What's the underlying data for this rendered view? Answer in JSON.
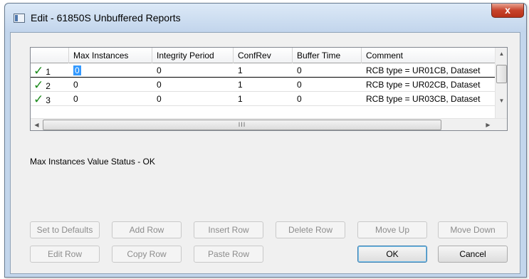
{
  "window": {
    "title": "Edit - 61850S Unbuffered Reports",
    "close_label": "x"
  },
  "grid": {
    "columns": [
      "Max Instances",
      "Integrity Period",
      "ConfRev",
      "Buffer Time",
      "Comment"
    ],
    "rows": [
      {
        "num": "1",
        "check": "✓",
        "max_instances": "0",
        "integrity_period": "0",
        "confrev": "1",
        "buffer_time": "0",
        "comment": "RCB type = UR01CB, Dataset"
      },
      {
        "num": "2",
        "check": "✓",
        "max_instances": "0",
        "integrity_period": "0",
        "confrev": "1",
        "buffer_time": "0",
        "comment": "RCB type = UR02CB, Dataset"
      },
      {
        "num": "3",
        "check": "✓",
        "max_instances": "0",
        "integrity_period": "0",
        "confrev": "1",
        "buffer_time": "0",
        "comment": "RCB type = UR03CB, Dataset"
      }
    ],
    "hscroll_grip": "III"
  },
  "status_text": "Max Instances Value Status - OK",
  "buttons": {
    "set_to_defaults": "Set to Defaults",
    "add_row": "Add Row",
    "insert_row": "Insert Row",
    "delete_row": "Delete Row",
    "move_up": "Move Up",
    "move_down": "Move Down",
    "edit_row": "Edit Row",
    "copy_row": "Copy Row",
    "paste_row": "Paste Row",
    "ok": "OK",
    "cancel": "Cancel"
  }
}
